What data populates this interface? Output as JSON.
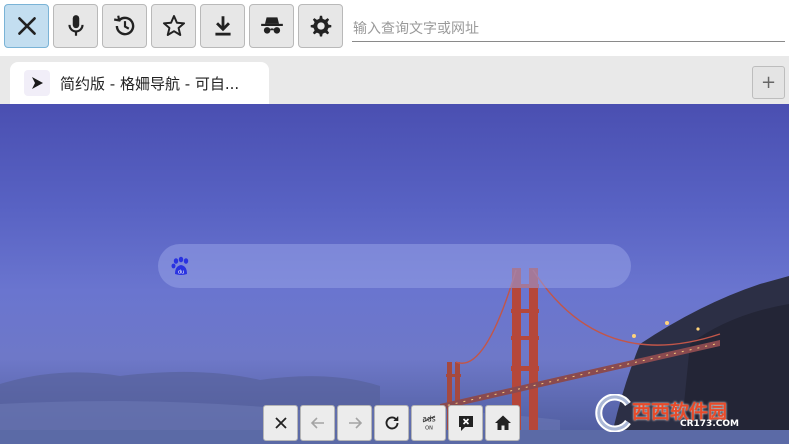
{
  "toolbar": {
    "buttons": [
      {
        "name": "close-button",
        "icon": "close-icon"
      },
      {
        "name": "voice-button",
        "icon": "microphone-icon"
      },
      {
        "name": "history-button",
        "icon": "history-icon"
      },
      {
        "name": "bookmark-button",
        "icon": "star-icon"
      },
      {
        "name": "download-button",
        "icon": "download-icon"
      },
      {
        "name": "incognito-button",
        "icon": "incognito-icon"
      },
      {
        "name": "settings-button",
        "icon": "gear-icon"
      }
    ],
    "url_placeholder": "输入查询文字或网址",
    "url_value": ""
  },
  "tabs": [
    {
      "title": "简约版 - 格姍导航 - 可自...",
      "icon": "play-icon",
      "active": true
    }
  ],
  "newtab_label": "+",
  "search_box": {
    "engine_icon": "baidu-paw-icon",
    "value": ""
  },
  "bottom_bar": {
    "buttons": [
      {
        "name": "close-page-button",
        "icon": "close-icon",
        "enabled": true
      },
      {
        "name": "back-button",
        "icon": "arrow-left-icon",
        "enabled": false
      },
      {
        "name": "forward-button",
        "icon": "arrow-right-icon",
        "enabled": false
      },
      {
        "name": "reload-button",
        "icon": "reload-icon",
        "enabled": true
      },
      {
        "name": "adblock-button",
        "icon": "ads-off-icon",
        "enabled": true,
        "label": "ads",
        "sublabel": "ON"
      },
      {
        "name": "feedback-button",
        "icon": "chat-x-icon",
        "enabled": true
      },
      {
        "name": "home-button",
        "icon": "home-icon",
        "enabled": true
      }
    ]
  },
  "watermark": {
    "text": "西西软件园",
    "sub": "CR173.COM"
  },
  "colors": {
    "accent": "#c3def0",
    "sky": "#5862c3",
    "bridge": "#b5473a",
    "baidu_blue": "#2932e1"
  }
}
